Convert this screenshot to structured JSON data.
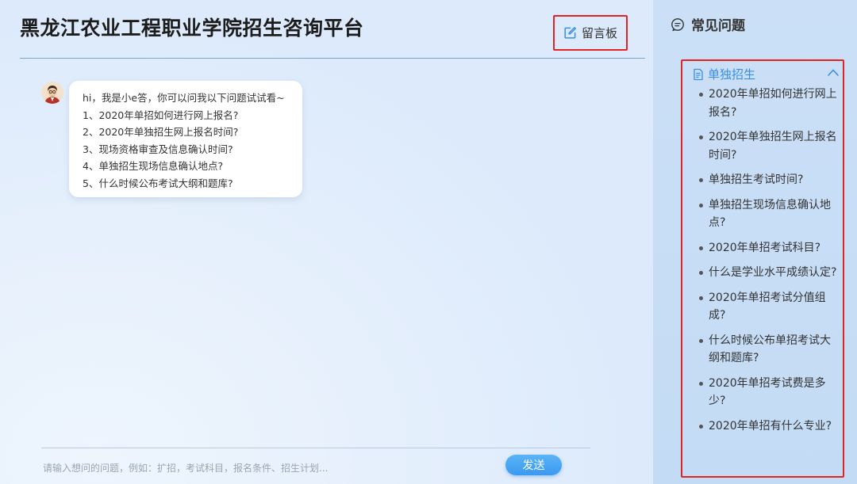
{
  "header": {
    "title": "黑龙江农业工程职业学院招生咨询平台",
    "message_board_label": "留言板"
  },
  "chat": {
    "greeting": "hi，我是小e答，你可以问我以下问题试试看~",
    "suggestions": [
      "1、2020年单招如何进行网上报名?",
      "2、2020年单独招生网上报名时间?",
      "3、现场资格审查及信息确认时间?",
      "4、单独招生现场信息确认地点?",
      "5、什么时候公布考试大纲和题库?"
    ]
  },
  "composer": {
    "placeholder": "请输入想问的问题，例如：扩招，考试科目，报名条件、招生计划...",
    "send_label": "发送"
  },
  "sidebar": {
    "title": "常见问题",
    "category": "单独招生",
    "questions": [
      "2020年单招如何进行网上报名?",
      "2020年单独招生网上报名时间?",
      "单独招生考试时间?",
      "单独招生现场信息确认地点?",
      "2020年单招考试科目?",
      "什么是学业水平成绩认定?",
      "2020年单招考试分值组成?",
      "什么时候公布单招考试大纲和题库?",
      "2020年单招考试费是多少?",
      "2020年单招有什么专业?"
    ]
  },
  "icons": {
    "message_board": "edit-icon",
    "faq": "chat-bubble-icon",
    "category": "document-icon",
    "collapse": "chevron-up-icon",
    "avatar": "teacher-avatar"
  },
  "colors": {
    "accent": "#3a8ee6",
    "highlight_border": "#e02424",
    "send_button": "#4aa6f3"
  }
}
